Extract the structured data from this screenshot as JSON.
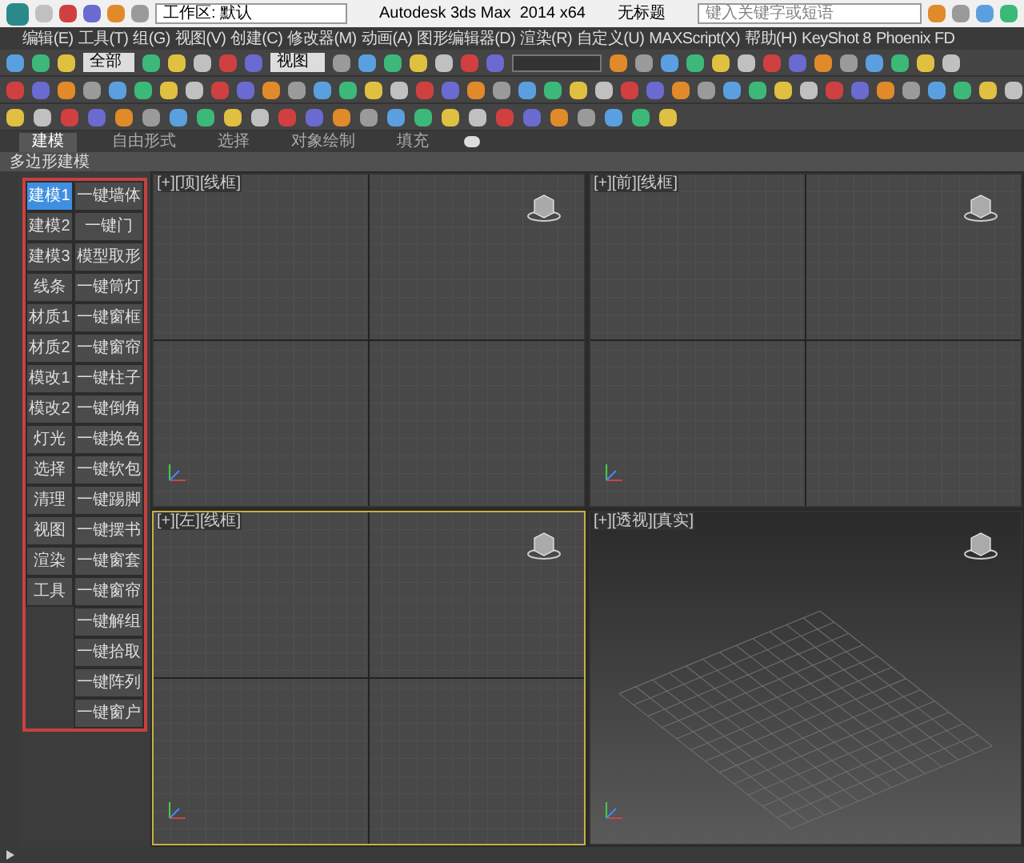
{
  "title_bar": {
    "app_title": "Autodesk 3ds Max  2014 x64",
    "document": "无标题",
    "workspace": "工作区: 默认",
    "search_placeholder": "键入关键字或短语"
  },
  "menu": [
    "编辑(E)",
    "工具(T)",
    "组(G)",
    "视图(V)",
    "创建(C)",
    "修改器(M)",
    "动画(A)",
    "图形编辑器(D)",
    "渲染(R)",
    "自定义(U)",
    "MAXScript(X)",
    "帮助(H)",
    "KeyShot 8",
    "Phoenix FD"
  ],
  "toolbar": {
    "selection_filter": "全部",
    "reference_coord": "视图"
  },
  "ribbon_tabs": [
    {
      "label": "建模",
      "selected": true
    },
    {
      "label": "自由形式",
      "selected": false
    },
    {
      "label": "选择",
      "selected": false
    },
    {
      "label": "对象绘制",
      "selected": false
    },
    {
      "label": "填充",
      "selected": false
    }
  ],
  "ribbon_panel_label": "多边形建模",
  "script_panel": {
    "left_buttons": [
      {
        "label": "建模1",
        "selected": true
      },
      {
        "label": "建模2",
        "selected": false
      },
      {
        "label": "建模3",
        "selected": false
      },
      {
        "label": "线条",
        "selected": false
      },
      {
        "label": "材质1",
        "selected": false
      },
      {
        "label": "材质2",
        "selected": false
      },
      {
        "label": "模改1",
        "selected": false
      },
      {
        "label": "模改2",
        "selected": false
      },
      {
        "label": "灯光",
        "selected": false
      },
      {
        "label": "选择",
        "selected": false
      },
      {
        "label": "清理",
        "selected": false
      },
      {
        "label": "视图",
        "selected": false
      },
      {
        "label": "渲染",
        "selected": false
      },
      {
        "label": "工具",
        "selected": false
      }
    ],
    "right_buttons": [
      "一键墙体",
      "一键门",
      "模型取形",
      "一键筒灯",
      "一键窗框",
      "一键窗帘",
      "一键柱子",
      "一键倒角",
      "一键换色",
      "一键软包",
      "一键踢脚",
      "一键摆书",
      "一键窗套",
      "一键窗帘",
      "一键解组",
      "一键拾取",
      "一键阵列",
      "一键窗户"
    ]
  },
  "viewports": [
    {
      "label": "[+][顶][线框]",
      "kind": "ortho",
      "active": false
    },
    {
      "label": "[+][前][线框]",
      "kind": "ortho",
      "active": false
    },
    {
      "label": "[+][左][线框]",
      "kind": "ortho",
      "active": true
    },
    {
      "label": "[+][透视][真实]",
      "kind": "perspective",
      "active": false
    }
  ]
}
